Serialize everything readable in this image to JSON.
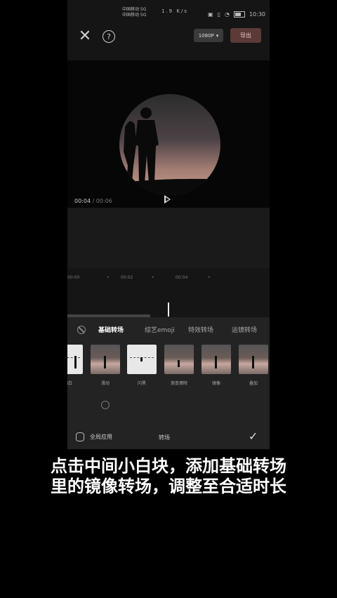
{
  "status_bar": {
    "carrier_1": "中国移动 5G",
    "carrier_2": "中国移动 5G",
    "network_speed": "1.9 K/s",
    "time": "10:30"
  },
  "top_bar": {
    "close_icon": "close-icon",
    "help_icon": "help-icon",
    "help_glyph": "?",
    "resolution_label": "1080P",
    "export_label": "导出"
  },
  "player": {
    "current_time": "00:04",
    "total_time": "00:06",
    "time_separator": " / "
  },
  "ruler": [
    "00:00",
    "00:02",
    "00:04"
  ],
  "transition_panel": {
    "tabs": [
      {
        "label": "基础转场",
        "active": true
      },
      {
        "label": "综艺emoji",
        "active": false
      },
      {
        "label": "特效转场",
        "active": false
      },
      {
        "label": "运镜转场",
        "active": false
      }
    ],
    "items": [
      {
        "label": "闪白",
        "style": "white"
      },
      {
        "label": "滑动",
        "style": "photo"
      },
      {
        "label": "闪黑",
        "style": "white"
      },
      {
        "label": "渐变擦除",
        "style": "photo"
      },
      {
        "label": "镜像",
        "style": "photo"
      },
      {
        "label": "叠加",
        "style": "photo"
      }
    ],
    "apply_all_label": "全局应用",
    "title": "转场",
    "confirm_icon": "check-icon"
  },
  "caption": {
    "line1": "点击中间小白块，添加基础转场",
    "line2": "里的镜像转场，调整至合适时长"
  },
  "colors": {
    "export_button": "#5b3a38",
    "background": "#000000",
    "panel": "#232323"
  }
}
